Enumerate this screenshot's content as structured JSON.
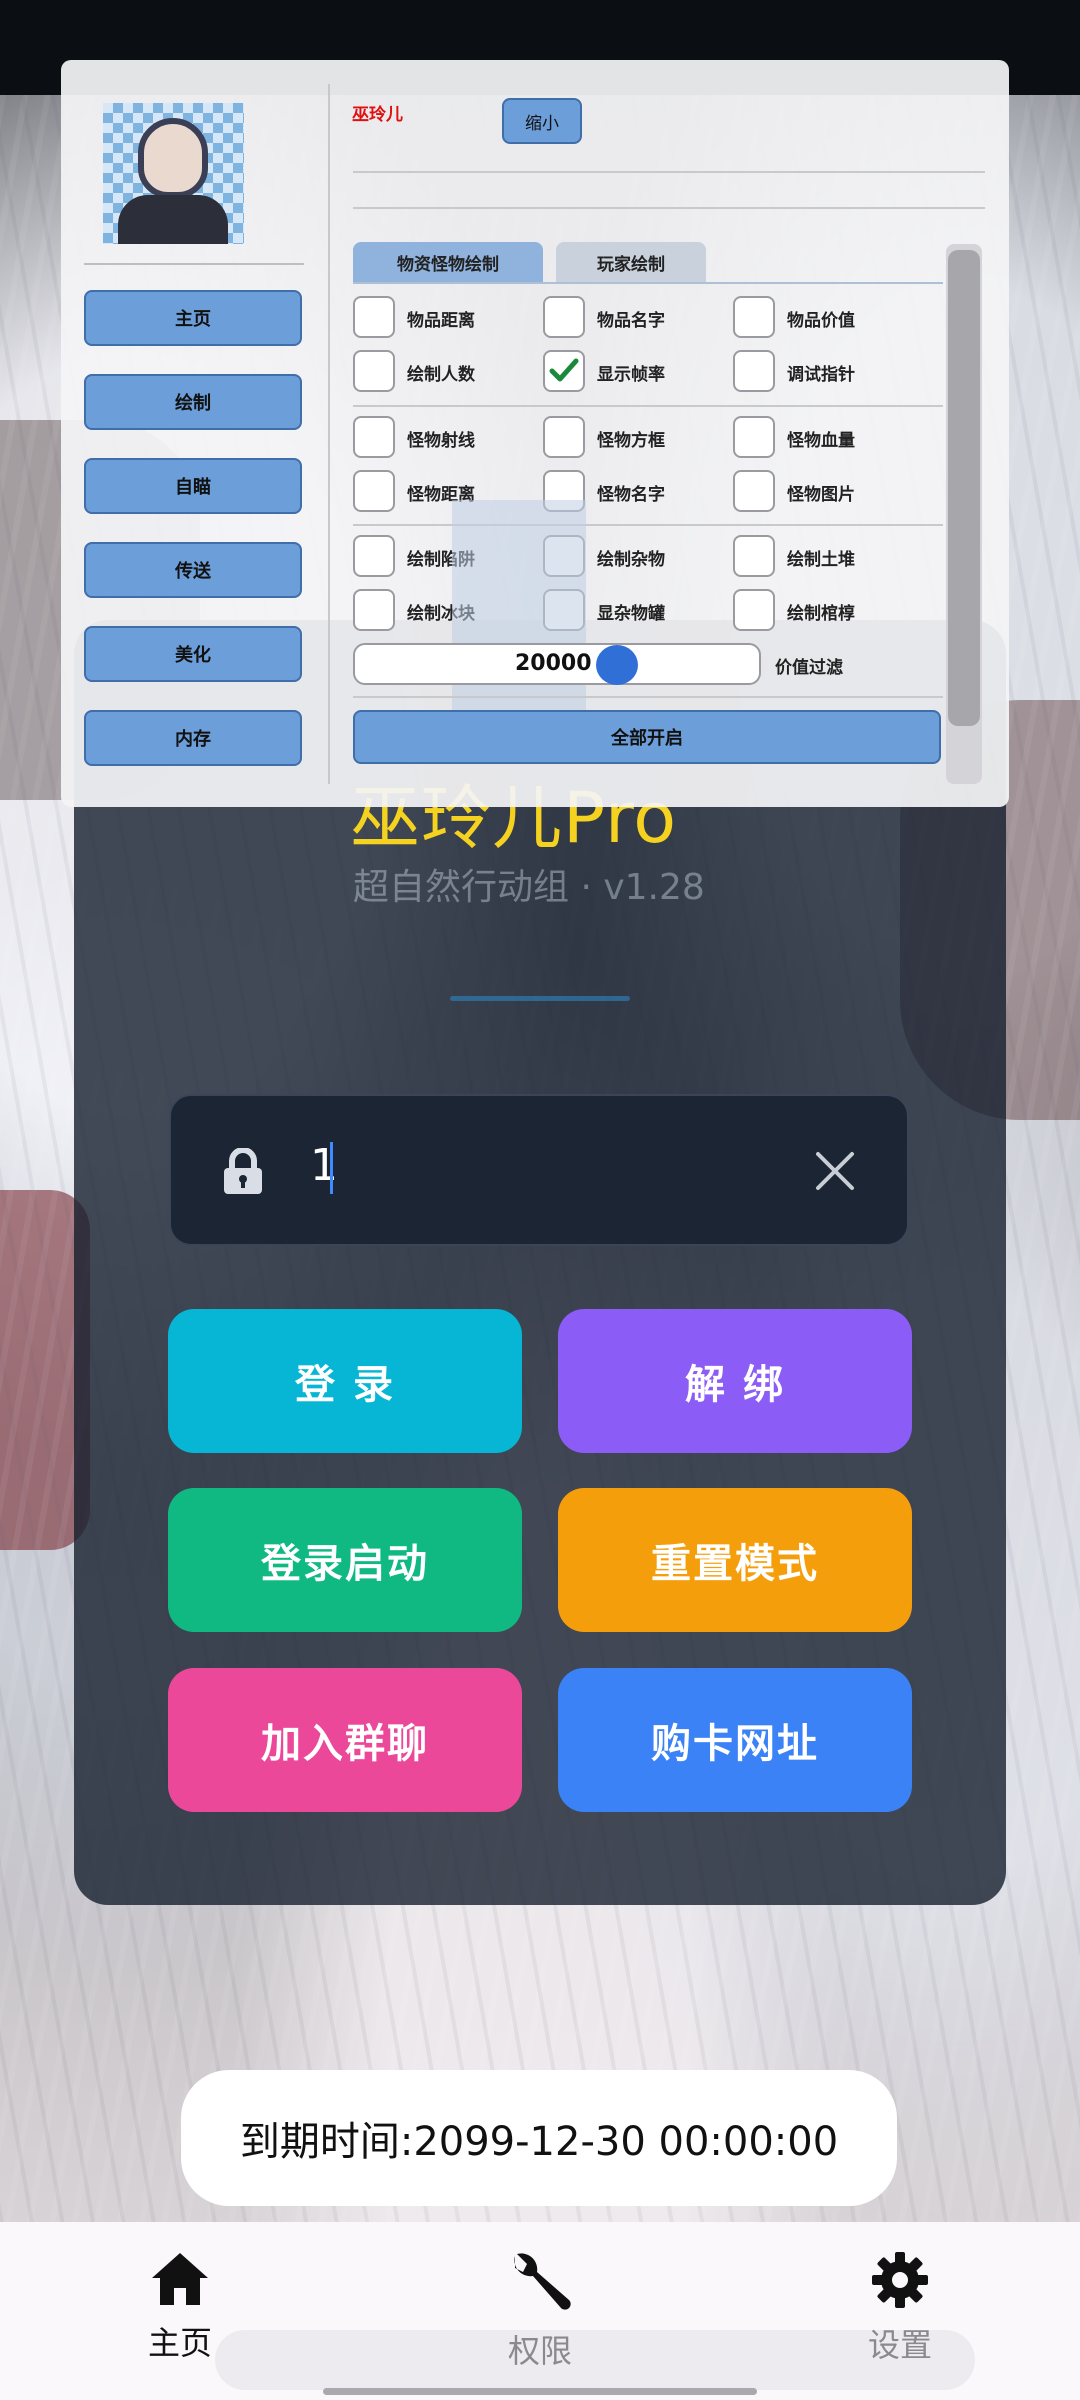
{
  "app": {
    "title": "巫玲儿Pro",
    "subtitle": "超自然行动组 · v1.28"
  },
  "login": {
    "input_value": "1",
    "lock_icon": "lock-icon",
    "clear_icon": "close-icon",
    "buttons": [
      {
        "label": "登 录",
        "color": "#06b6d4"
      },
      {
        "label": "解 绑",
        "color": "#8b5cf6"
      },
      {
        "label": "登录启动",
        "color": "#10b981"
      },
      {
        "label": "重置模式",
        "color": "#f59e0b"
      },
      {
        "label": "加入群聊",
        "color": "#ec4899"
      },
      {
        "label": "购卡网址",
        "color": "#3b82f6"
      }
    ]
  },
  "toast": {
    "text": "到期时间:2099-12-30 00:00:00"
  },
  "bottom_nav": [
    {
      "label": "主页",
      "icon": "home-icon",
      "active": true
    },
    {
      "label": "权限",
      "icon": "wrench-icon",
      "active": false
    },
    {
      "label": "设置",
      "icon": "gear-icon",
      "active": false
    }
  ],
  "menu": {
    "name": "巫玲儿",
    "shrink_label": "缩小",
    "side_buttons": [
      "主页",
      "绘制",
      "自瞄",
      "传送",
      "美化",
      "内存"
    ],
    "tabs": [
      "物资怪物绘制",
      "玩家绘制"
    ],
    "options": [
      {
        "label": "物品距离",
        "checked": false
      },
      {
        "label": "物品名字",
        "checked": false
      },
      {
        "label": "物品价值",
        "checked": false
      },
      {
        "label": "绘制人数",
        "checked": false
      },
      {
        "label": "显示帧率",
        "checked": true
      },
      {
        "label": "调试指针",
        "checked": false
      },
      {
        "label": "怪物射线",
        "checked": false
      },
      {
        "label": "怪物方框",
        "checked": false
      },
      {
        "label": "怪物血量",
        "checked": false
      },
      {
        "label": "怪物距离",
        "checked": false
      },
      {
        "label": "怪物名字",
        "checked": false
      },
      {
        "label": "怪物图片",
        "checked": false
      },
      {
        "label": "绘制陷阱",
        "checked": false
      },
      {
        "label": "绘制杂物",
        "checked": false
      },
      {
        "label": "绘制土堆",
        "checked": false
      },
      {
        "label": "绘制冰块",
        "checked": false
      },
      {
        "label": "显杂物罐",
        "checked": false
      },
      {
        "label": "绘制棺椁",
        "checked": false
      }
    ],
    "slider": {
      "value": "20000",
      "label": "价值过滤"
    },
    "all_on_label": "全部开启"
  }
}
